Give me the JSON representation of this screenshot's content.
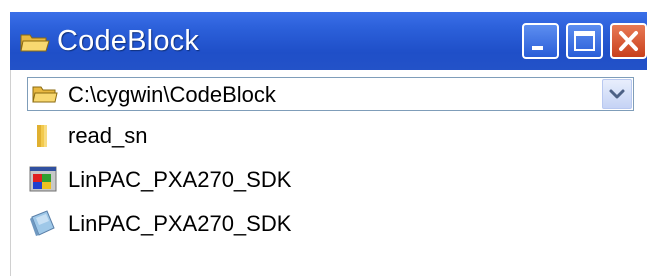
{
  "window": {
    "title": "CodeBlock",
    "title_icon": "folder-icon",
    "buttons": {
      "minimize_icon": "minimize-icon",
      "maximize_icon": "maximize-icon",
      "close_icon": "close-icon"
    },
    "colors": {
      "titlebar": "#2b5fd9",
      "close_button": "#d4522a"
    }
  },
  "address_bar": {
    "icon": "folder-icon",
    "path": "C:\\cygwin\\CodeBlock",
    "dropdown_icon": "chevron-down-icon"
  },
  "files": [
    {
      "name": "read_sn",
      "icon": "folder-icon"
    },
    {
      "name": "LinPAC_PXA270_SDK",
      "icon": "application-icon"
    },
    {
      "name": "LinPAC_PXA270_SDK",
      "icon": "document-icon"
    }
  ]
}
